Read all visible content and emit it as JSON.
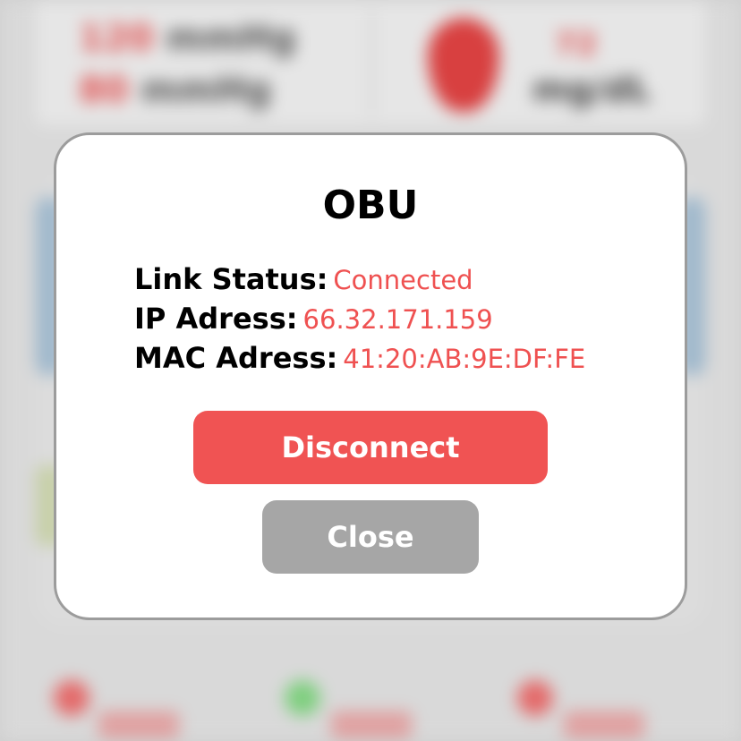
{
  "background": {
    "header_rows": [
      {
        "value": "120",
        "unit": "mmHg"
      },
      {
        "value": "80",
        "unit": "mmHg"
      }
    ],
    "drop_value": "72",
    "drop_unit": "mg/dL"
  },
  "modal": {
    "title": "OBU",
    "rows": [
      {
        "label": "Link Status:",
        "value": "Connected"
      },
      {
        "label": "IP Adress:",
        "value": "66.32.171.159"
      },
      {
        "label": "MAC Adress:",
        "value": "41:20:AB:9E:DF:FE"
      }
    ],
    "disconnect_label": "Disconnect",
    "close_label": "Close"
  },
  "colors": {
    "accent": "#f05353",
    "value_text": "#ef5151",
    "close_button": "#a6a6a6",
    "modal_border": "#9c9c9c"
  }
}
